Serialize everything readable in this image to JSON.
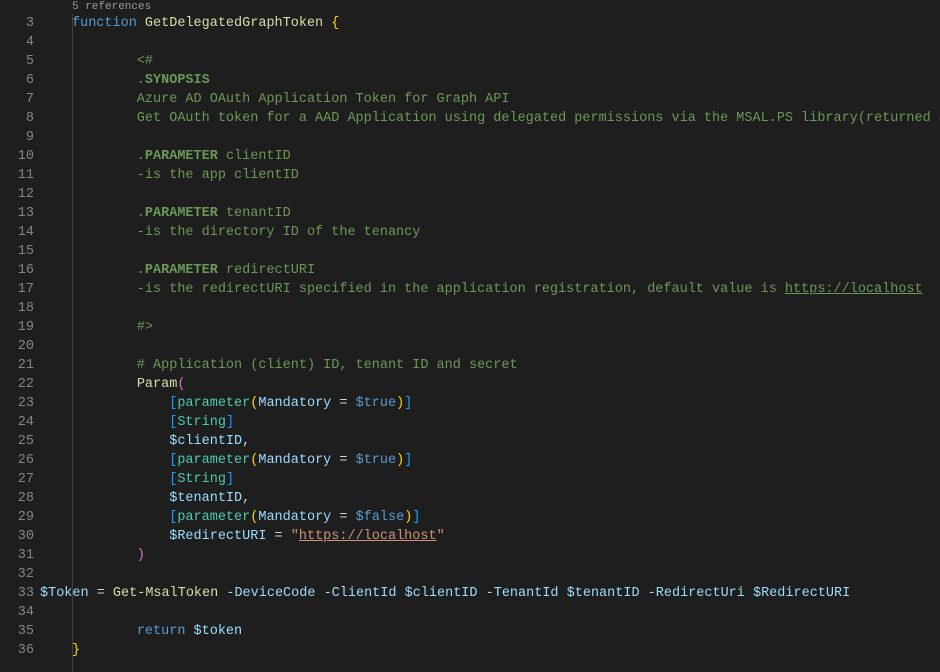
{
  "codelens": "5 references",
  "lineNumbers": [
    "3",
    "4",
    "5",
    "6",
    "7",
    "8",
    "9",
    "10",
    "11",
    "12",
    "13",
    "14",
    "15",
    "16",
    "17",
    "18",
    "19",
    "20",
    "21",
    "22",
    "23",
    "24",
    "25",
    "26",
    "27",
    "28",
    "29",
    "30",
    "31",
    "32",
    "33",
    "34",
    "35",
    "36"
  ],
  "l3": {
    "func": "function",
    "name": "GetDelegatedGraphToken",
    "brace": " {"
  },
  "l5": "        <#",
  "l6": {
    "pre": "        .",
    "kw": "SYNOPSIS"
  },
  "l7": "        Azure AD OAuth Application Token for Graph API",
  "l8": "        Get OAuth token for a AAD Application using delegated permissions via the MSAL.PS library(returned as $token)",
  "l10": {
    "pre": "        .",
    "kw": "PARAMETER",
    "rest": " clientID"
  },
  "l11": "        -is the app clientID",
  "l13": {
    "pre": "        .",
    "kw": "PARAMETER",
    "rest": " tenantID"
  },
  "l14": "        -is the directory ID of the tenancy",
  "l16": {
    "pre": "        .",
    "kw": "PARAMETER",
    "rest": " redirectURI"
  },
  "l17": {
    "a": "        -is the redirectURI specified in the application registration, default value is ",
    "url": "https://localhost"
  },
  "l19": "        #>",
  "l21": "        # Application (client) ID, tenant ID and secret",
  "l22": {
    "paramKw": "Param"
  },
  "l23": {
    "attr": "parameter",
    "prop": "Mandatory",
    "val": "$true"
  },
  "l24": {
    "type": "String"
  },
  "l25": {
    "var": "$clientID"
  },
  "l26": {
    "attr": "parameter",
    "prop": "Mandatory",
    "val": "$true"
  },
  "l27": {
    "type": "String"
  },
  "l28": {
    "var": "$tenantID"
  },
  "l29": {
    "attr": "parameter",
    "prop": "Mandatory",
    "val": "$false"
  },
  "l30": {
    "var": "$RedirectURI",
    "eq": " = ",
    "q1": "\"",
    "str": "https://localhost",
    "q2": "\""
  },
  "l33": {
    "var1": "$Token",
    "eq": " = ",
    "cmd": "Get-MsalToken",
    "p1": " -DeviceCode",
    "p2": " -ClientId ",
    "v2": "$clientID",
    "p3": " -TenantId ",
    "v3": "$tenantID",
    "p4": " -RedirectUri ",
    "v4": "$RedirectURI"
  },
  "l35": {
    "kw": "return",
    "sp": " ",
    "var": "$token"
  }
}
